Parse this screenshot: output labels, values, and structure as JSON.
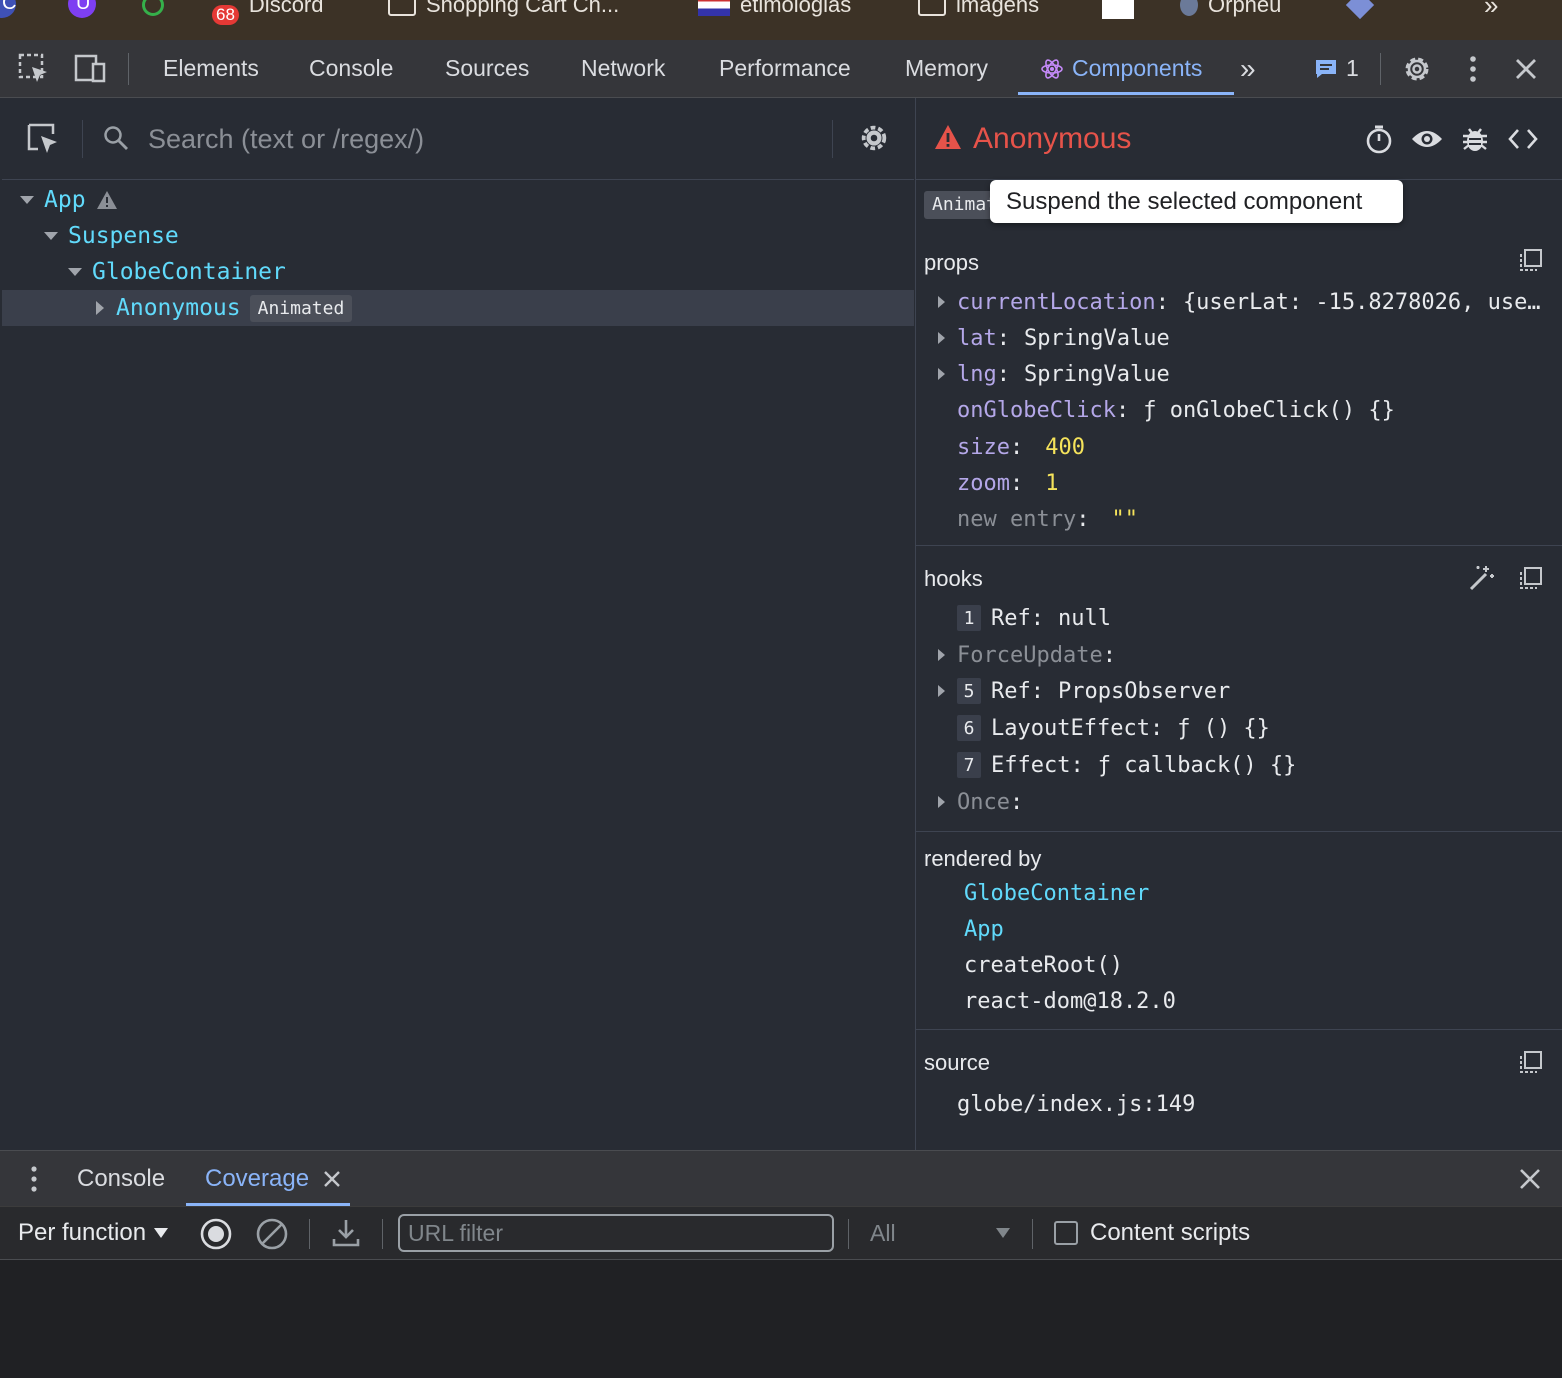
{
  "bookmarks": [
    {
      "label": "Discord",
      "badge": "68"
    },
    {
      "label": "Shopping Cart Ch..."
    },
    {
      "label": "etimologias"
    },
    {
      "label": "imagens"
    },
    {
      "label": "Orpheu"
    }
  ],
  "bookmark_letters": [
    "C",
    "U"
  ],
  "devtools_tabs": [
    "Elements",
    "Console",
    "Sources",
    "Network",
    "Performance",
    "Memory",
    "Components"
  ],
  "active_tab": "Components",
  "issues_count": "1",
  "left": {
    "search_placeholder": "Search (text or /regex/)",
    "tree": [
      {
        "name": "App",
        "warning": true
      },
      {
        "name": "Suspense"
      },
      {
        "name": "GlobeContainer"
      },
      {
        "name": "Anonymous",
        "badge": "Animated",
        "selected": true
      }
    ]
  },
  "right": {
    "title": "Anonymous",
    "badge_partial": "Animated",
    "tooltip": "Suspend the selected component",
    "props_title": "props",
    "props": [
      {
        "key": "currentLocation",
        "value": "{userLat: -15.8278026, use…",
        "expandable": true
      },
      {
        "key": "lat",
        "value": "SpringValue",
        "expandable": true
      },
      {
        "key": "lng",
        "value": "SpringValue",
        "expandable": true
      },
      {
        "key": "onGlobeClick",
        "value": "ƒ onGlobeClick() {}"
      },
      {
        "key": "size",
        "value": "400",
        "type": "number"
      },
      {
        "key": "zoom",
        "value": "1",
        "type": "number"
      },
      {
        "key": "new entry",
        "value": "\"\"",
        "type": "string",
        "dim": true
      }
    ],
    "hooks_title": "hooks",
    "hooks": [
      {
        "index": "1",
        "name": "Ref",
        "value": "null"
      },
      {
        "name": "ForceUpdate",
        "value": "",
        "expandable": true,
        "dim": true
      },
      {
        "index": "5",
        "name": "Ref",
        "value": "PropsObserver",
        "expandable": true
      },
      {
        "index": "6",
        "name": "LayoutEffect",
        "value": "ƒ () {}"
      },
      {
        "index": "7",
        "name": "Effect",
        "value": "ƒ callback() {}"
      },
      {
        "name": "Once",
        "value": "",
        "expandable": true,
        "dim": true
      }
    ],
    "rendered_by_title": "rendered by",
    "rendered_by": [
      {
        "label": "GlobeContainer",
        "link": true
      },
      {
        "label": "App",
        "link": true
      },
      {
        "label": "createRoot()"
      },
      {
        "label": "react-dom@18.2.0"
      }
    ],
    "source_title": "source",
    "source": "globe/index.js:149"
  },
  "drawer": {
    "tabs": [
      "Console",
      "Coverage"
    ],
    "active_tab": "Coverage",
    "mode_label": "Per function",
    "url_filter_placeholder": "URL filter",
    "type_filter": "All",
    "content_scripts_label": "Content scripts"
  },
  "colors": {
    "accent": "#8ab4f8",
    "component": "#61dafb",
    "warning": "#e6534a",
    "prop_key": "#b4a7e8",
    "number": "#f5e35b"
  }
}
